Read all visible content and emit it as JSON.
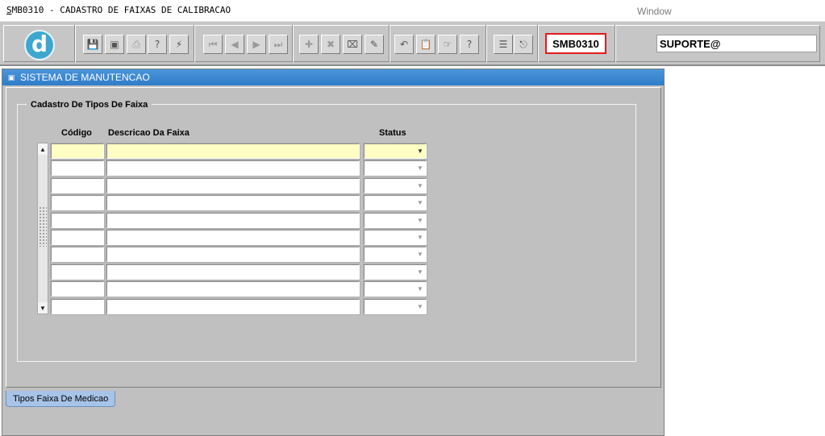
{
  "menubar": {
    "title_underlined": "S",
    "title_rest": "MB0310 - CADASTRO DE FAIXAS DE CALIBRACAO",
    "window_menu": "Window"
  },
  "toolbar": {
    "form_code": "SMB0310",
    "user": "SUPORTE@",
    "buttons": [
      {
        "name": "save-icon",
        "glyph": "💾",
        "dim": true
      },
      {
        "name": "window-icon",
        "glyph": "▣",
        "dim": false
      },
      {
        "name": "print-icon",
        "glyph": "⎙",
        "dim": true
      },
      {
        "name": "query-icon",
        "glyph": "?",
        "dim": false
      },
      {
        "name": "execute-query-icon",
        "glyph": "⚡",
        "dim": false
      },
      {
        "name": "first-record-icon",
        "glyph": "⏮",
        "dim": true
      },
      {
        "name": "previous-record-icon",
        "glyph": "◀",
        "dim": true
      },
      {
        "name": "next-record-icon",
        "glyph": "▶",
        "dim": true
      },
      {
        "name": "last-record-icon",
        "glyph": "⏭",
        "dim": true
      },
      {
        "name": "insert-record-icon",
        "glyph": "✚",
        "dim": true
      },
      {
        "name": "delete-record-icon",
        "glyph": "✖",
        "dim": true
      },
      {
        "name": "clear-record-icon",
        "glyph": "⌧",
        "dim": false
      },
      {
        "name": "edit-icon",
        "glyph": "✎",
        "dim": false
      },
      {
        "name": "undo-icon",
        "glyph": "↶",
        "dim": false
      },
      {
        "name": "clipboard-icon",
        "glyph": "📋",
        "dim": true
      },
      {
        "name": "list-values-icon",
        "glyph": "☞",
        "dim": false
      },
      {
        "name": "help-icon",
        "glyph": "?",
        "dim": false
      },
      {
        "name": "menu-icon",
        "glyph": "☰",
        "dim": false
      },
      {
        "name": "exit-icon",
        "glyph": "⎋",
        "dim": false
      }
    ]
  },
  "window": {
    "title": "SISTEMA DE MANUTENCAO",
    "frame_title": "Cadastro De Tipos De Faixa",
    "columns": {
      "codigo": "Código",
      "descricao": "Descricao Da Faixa",
      "status": "Status"
    },
    "rows": [
      {
        "codigo": "",
        "descricao": "",
        "status": ""
      },
      {
        "codigo": "",
        "descricao": "",
        "status": ""
      },
      {
        "codigo": "",
        "descricao": "",
        "status": ""
      },
      {
        "codigo": "",
        "descricao": "",
        "status": ""
      },
      {
        "codigo": "",
        "descricao": "",
        "status": ""
      },
      {
        "codigo": "",
        "descricao": "",
        "status": ""
      },
      {
        "codigo": "",
        "descricao": "",
        "status": ""
      },
      {
        "codigo": "",
        "descricao": "",
        "status": ""
      },
      {
        "codigo": "",
        "descricao": "",
        "status": ""
      },
      {
        "codigo": "",
        "descricao": "",
        "status": ""
      }
    ],
    "tab_label": "Tipos Faixa De Medicao"
  },
  "colors": {
    "toolbar_bg": "#c6c6c6",
    "titlebar_blue": "#2f7cc8",
    "active_row": "#ffffc4",
    "form_code_border": "#e31b1b",
    "logo_blue": "#3fa7cf"
  }
}
